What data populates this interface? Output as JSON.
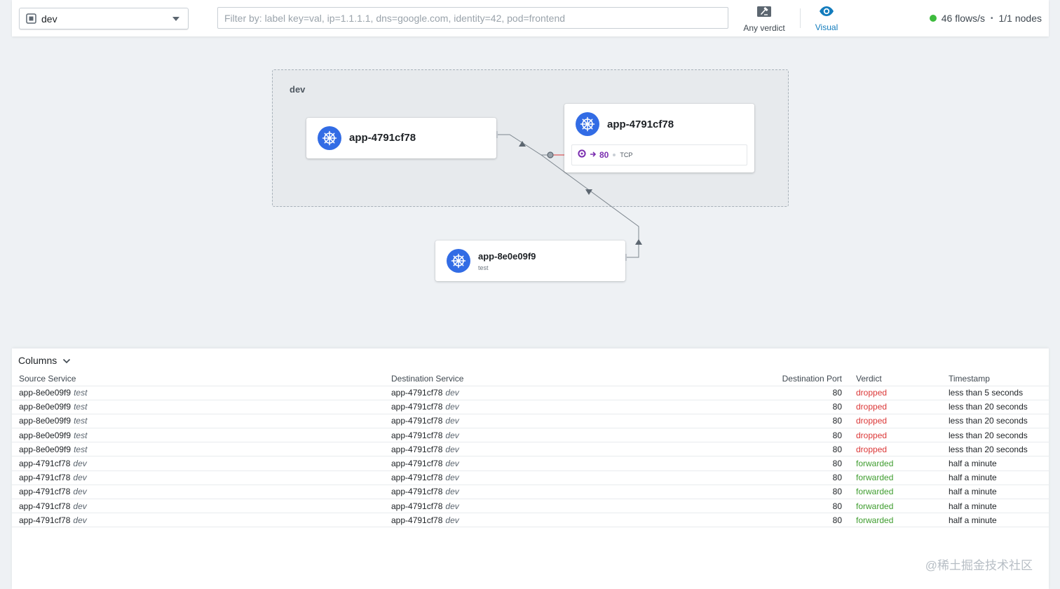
{
  "header": {
    "namespace": "dev",
    "filter_placeholder": "Filter by: label key=val, ip=1.1.1.1, dns=google.com, identity=42, pod=frontend",
    "verdict_label": "Any verdict",
    "visual_label": "Visual",
    "flows_rate": "46 flows/s",
    "bullet": "•",
    "nodes": "1/1 nodes",
    "status_color": "#3dbb3d"
  },
  "map": {
    "namespace_box": "dev",
    "cards": [
      {
        "title": "app-4791cf78",
        "subtitle": ""
      },
      {
        "title": "app-4791cf78",
        "subtitle": "",
        "port": "80",
        "protocol": "TCP"
      },
      {
        "title": "app-8e0e09f9",
        "subtitle": "test"
      }
    ]
  },
  "table": {
    "columns_label": "Columns",
    "headers": [
      "Source Service",
      "Destination Service",
      "Destination Port",
      "Verdict",
      "Timestamp"
    ],
    "rows": [
      {
        "src": "app-8e0e09f9",
        "src_ns": "test",
        "dst": "app-4791cf78",
        "dst_ns": "dev",
        "port": "80",
        "verdict": "dropped",
        "time": "less than 5 seconds"
      },
      {
        "src": "app-8e0e09f9",
        "src_ns": "test",
        "dst": "app-4791cf78",
        "dst_ns": "dev",
        "port": "80",
        "verdict": "dropped",
        "time": "less than 20 seconds"
      },
      {
        "src": "app-8e0e09f9",
        "src_ns": "test",
        "dst": "app-4791cf78",
        "dst_ns": "dev",
        "port": "80",
        "verdict": "dropped",
        "time": "less than 20 seconds"
      },
      {
        "src": "app-8e0e09f9",
        "src_ns": "test",
        "dst": "app-4791cf78",
        "dst_ns": "dev",
        "port": "80",
        "verdict": "dropped",
        "time": "less than 20 seconds"
      },
      {
        "src": "app-8e0e09f9",
        "src_ns": "test",
        "dst": "app-4791cf78",
        "dst_ns": "dev",
        "port": "80",
        "verdict": "dropped",
        "time": "less than 20 seconds"
      },
      {
        "src": "app-4791cf78",
        "src_ns": "dev",
        "dst": "app-4791cf78",
        "dst_ns": "dev",
        "port": "80",
        "verdict": "forwarded",
        "time": "half a minute"
      },
      {
        "src": "app-4791cf78",
        "src_ns": "dev",
        "dst": "app-4791cf78",
        "dst_ns": "dev",
        "port": "80",
        "verdict": "forwarded",
        "time": "half a minute"
      },
      {
        "src": "app-4791cf78",
        "src_ns": "dev",
        "dst": "app-4791cf78",
        "dst_ns": "dev",
        "port": "80",
        "verdict": "forwarded",
        "time": "half a minute"
      },
      {
        "src": "app-4791cf78",
        "src_ns": "dev",
        "dst": "app-4791cf78",
        "dst_ns": "dev",
        "port": "80",
        "verdict": "forwarded",
        "time": "half a minute"
      },
      {
        "src": "app-4791cf78",
        "src_ns": "dev",
        "dst": "app-4791cf78",
        "dst_ns": "dev",
        "port": "80",
        "verdict": "forwarded",
        "time": "half a minute"
      }
    ]
  },
  "colors": {
    "dropped": "#db3737",
    "forwarded": "#3f9d2f",
    "accent": "#137cbd",
    "kubernetes": "#326ce5",
    "port": "#7b2fb0"
  },
  "watermark": "@稀土掘金技术社区"
}
